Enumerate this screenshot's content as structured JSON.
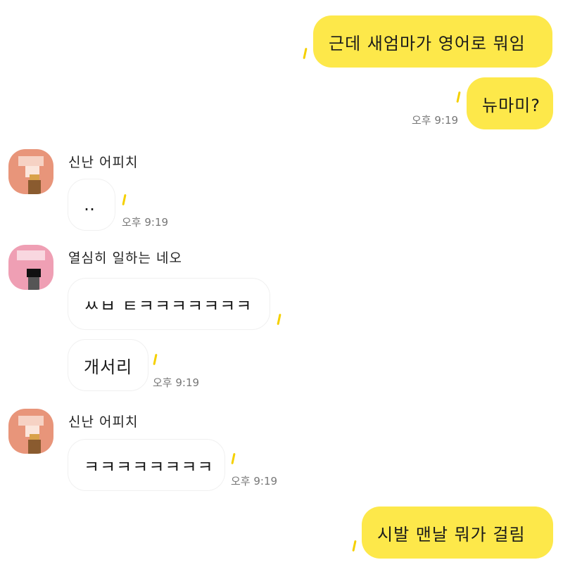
{
  "messages": {
    "m1": "근데 새엄마가 영어로 뭐임",
    "m2": "뉴마미?",
    "m2_time": "오후 9:19",
    "m3_name": "신난 어피치",
    "m3": "‥",
    "m3_time": "오후 9:19",
    "m4_name": "열심히 일하는 네오",
    "m4a": "ㅆㅂ ㅌㅋㅋㅋㅋㅋㅋㅋ",
    "m4b": "개서리",
    "m4_time": "오후 9:19",
    "m5_name": "신난 어피치",
    "m5": "ㅋㅋㅋㅋㅋㅋㅋㅋ",
    "m5_time": "오후 9:19",
    "m6": "시발 맨날 뭐가 걸림"
  },
  "colors": {
    "my_bubble": "#fde84a",
    "other_bubble": "#ffffff"
  }
}
